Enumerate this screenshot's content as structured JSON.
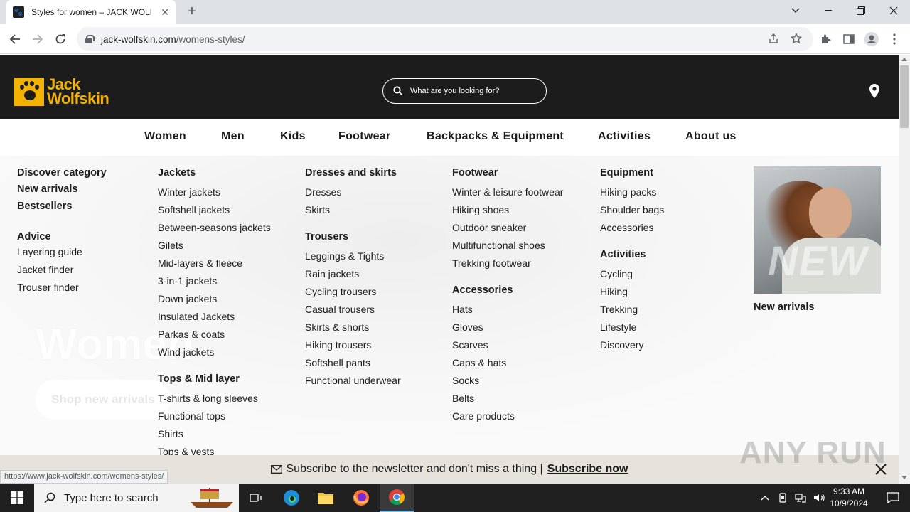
{
  "browser": {
    "tab_title": "Styles for women – JACK WOLFSKIN",
    "url_host": "jack-wolfskin.com",
    "url_path": "/womens-styles/",
    "status_url": "https://www.jack-wolfskin.com/womens-styles/"
  },
  "header": {
    "logo_line1": "Jack",
    "logo_line2": "Wolfskin",
    "search_placeholder": "What are you looking for?",
    "brand_color": "#f4b300"
  },
  "nav": [
    "Women",
    "Men",
    "Kids",
    "Footwear",
    "Backpacks & Equipment",
    "Activities",
    "About us"
  ],
  "menu": {
    "col1": {
      "heads": [
        "Discover category",
        "New arrivals",
        "Bestsellers",
        "Advice"
      ],
      "links": [
        "Layering guide",
        "Jacket finder",
        "Trouser finder"
      ]
    },
    "col2": {
      "head1": "Jackets",
      "links1": [
        "Winter jackets",
        "Softshell jackets",
        "Between-seasons jackets",
        "Gilets",
        "Mid-layers & fleece",
        "3-in-1 jackets",
        "Down jackets",
        "Insulated Jackets",
        "Parkas & coats",
        "Wind jackets"
      ],
      "head2": "Tops & Mid layer",
      "links2": [
        "T-shirts & long sleeves",
        "Functional tops",
        "Shirts",
        "Tops & vests"
      ]
    },
    "col3": {
      "head1": "Dresses and skirts",
      "links1": [
        "Dresses",
        "Skirts"
      ],
      "head2": "Trousers",
      "links2": [
        "Leggings & Tights",
        "Rain jackets",
        "Cycling trousers",
        "Casual trousers",
        "Skirts & shorts",
        "Hiking trousers",
        "Softshell pants",
        "Functional underwear"
      ]
    },
    "col4": {
      "head1": "Footwear",
      "links1": [
        "Winter & leisure footwear",
        "Hiking shoes",
        "Outdoor sneaker",
        "Multifunctional shoes",
        "Trekking footwear"
      ],
      "head2": "Accessories",
      "links2": [
        "Hats",
        "Gloves",
        "Scarves",
        "Caps & hats",
        "Socks",
        "Belts",
        "Care products"
      ]
    },
    "col5": {
      "head1": "Equipment",
      "links1": [
        "Hiking packs",
        "Shoulder bags",
        "Accessories"
      ],
      "head2": "Activities",
      "links2": [
        "Cycling",
        "Hiking",
        "Trekking",
        "Lifestyle",
        "Discovery"
      ]
    },
    "promo": {
      "image_text": "NEW",
      "caption": "New arrivals"
    }
  },
  "background": {
    "hero_word": "Women",
    "hero_button": "Shop new arrivals"
  },
  "newsletter": {
    "text": "Subscribe to the newsletter and don't miss a thing |",
    "link": "Subscribe now"
  },
  "watermark": "ANY RUN",
  "taskbar": {
    "search_placeholder": "Type here to search",
    "time": "9:33 AM",
    "date": "10/9/2024"
  }
}
